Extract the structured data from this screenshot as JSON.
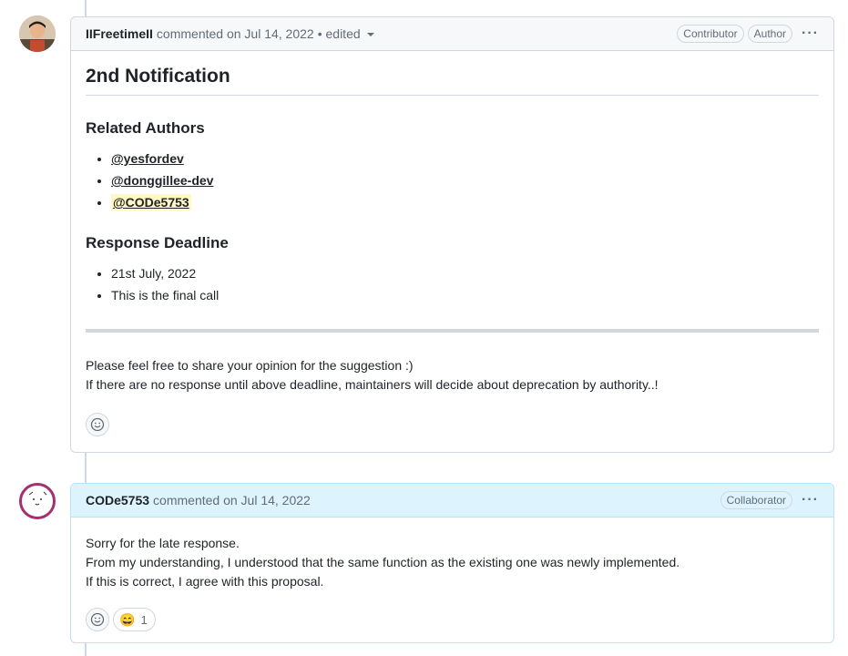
{
  "comments": [
    {
      "author": "IIFreetimeII",
      "meta": "commented on Jul 14, 2022",
      "edited": "• edited",
      "badges": [
        "Contributor",
        "Author"
      ],
      "title": "2nd Notification",
      "sections": [
        {
          "heading": "Related Authors",
          "items": [
            "@yesfordev",
            "@donggillee-dev",
            "@CODe5753"
          ]
        },
        {
          "heading": "Response Deadline",
          "items": [
            "21st July, 2022",
            "This is the final call"
          ]
        }
      ],
      "paragraphs": [
        "Please feel free to share your opinion for the suggestion :)",
        "If there are no response until above deadline, maintainers will decide about deprecation by authority..!"
      ]
    },
    {
      "author": "CODe5753",
      "meta": "commented on Jul 14, 2022",
      "badges": [
        "Collaborator"
      ],
      "paragraphs": [
        "Sorry for the late response.",
        "From my understanding, I understood that the same function as the existing one was newly implemented.",
        "If this is correct, I agree with this proposal."
      ],
      "reactions": [
        {
          "emoji": "😄",
          "count": "1"
        }
      ]
    }
  ],
  "icons": {
    "reaction": "smiley-icon",
    "more": "kebab-horizontal-icon"
  }
}
